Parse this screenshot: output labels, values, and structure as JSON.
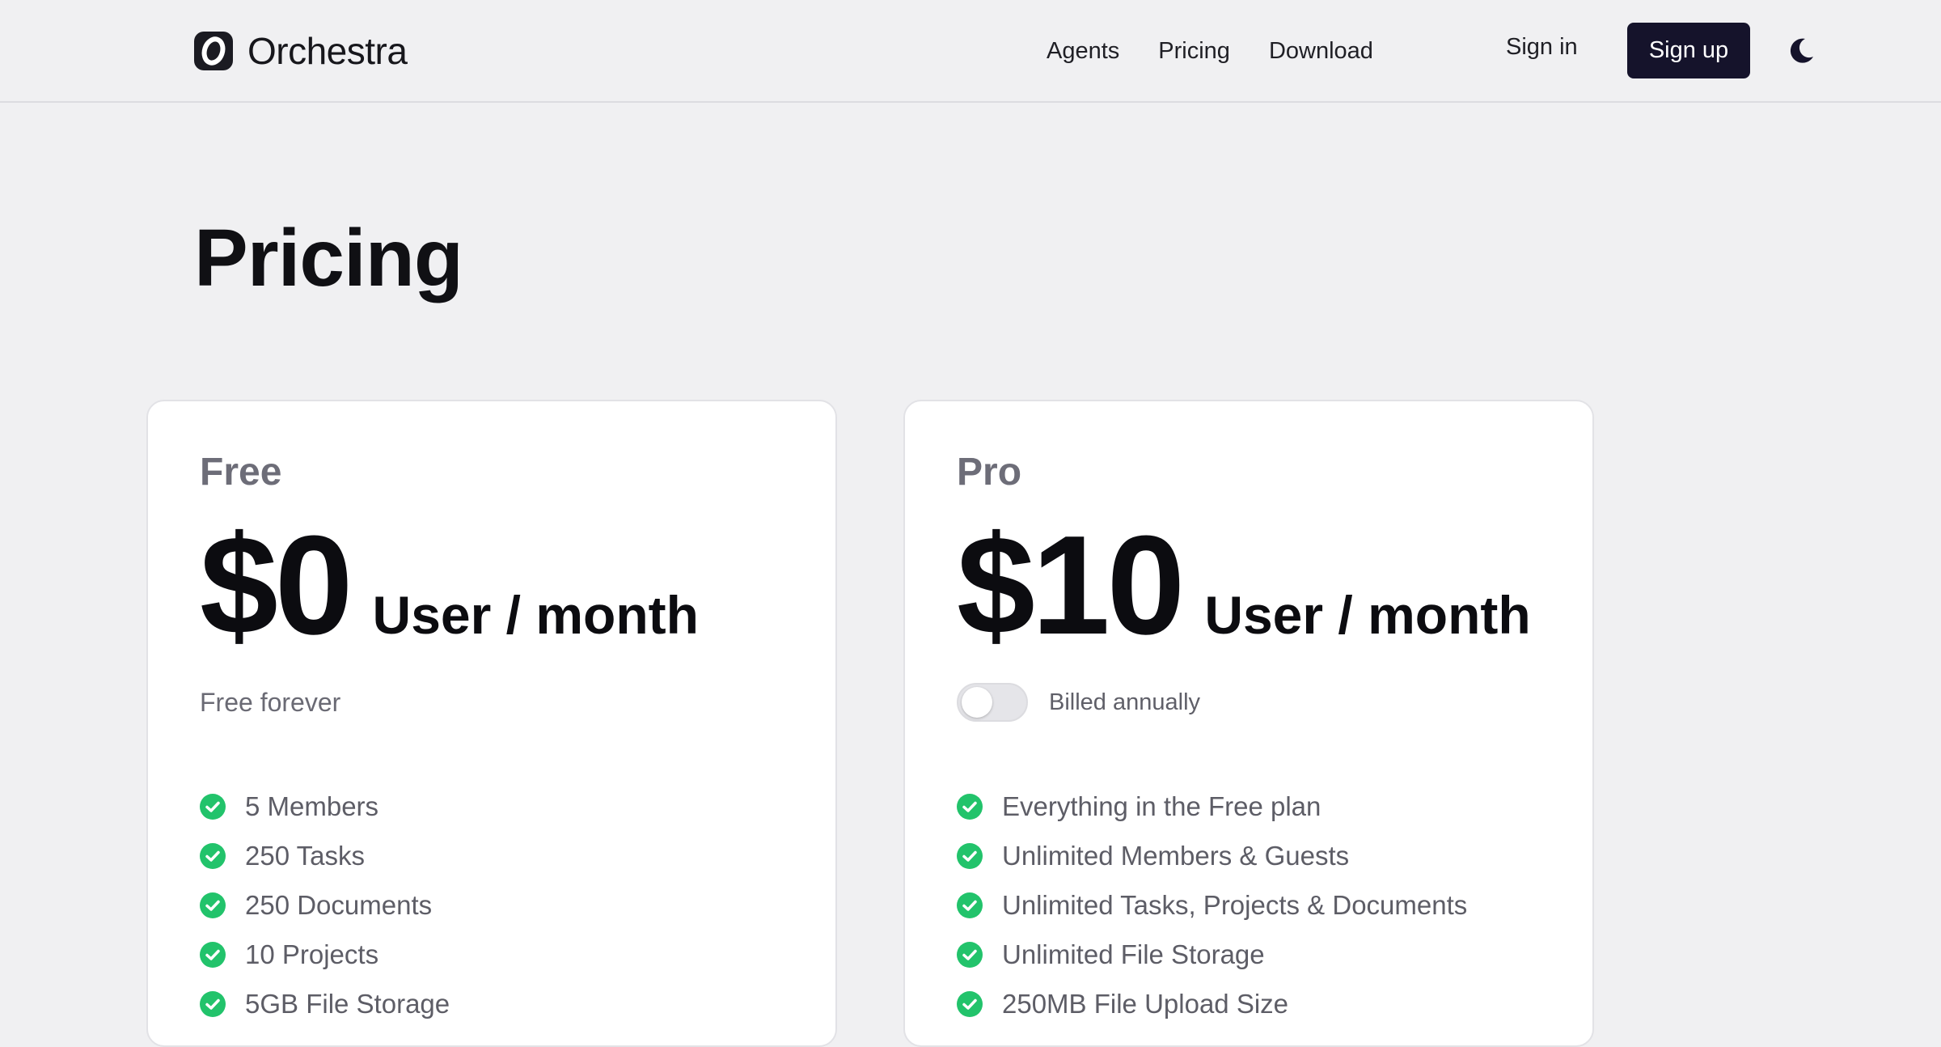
{
  "header": {
    "brand": "Orchestra",
    "nav": [
      "Agents",
      "Pricing",
      "Download"
    ],
    "sign_in": "Sign in",
    "sign_up": "Sign up"
  },
  "page": {
    "title": "Pricing"
  },
  "plans": [
    {
      "name": "Free",
      "price": "$0",
      "unit": "User / month",
      "subtitle": "Free forever",
      "features": [
        "5 Members",
        "250 Tasks",
        "250 Documents",
        "10 Projects",
        "5GB File Storage"
      ]
    },
    {
      "name": "Pro",
      "price": "$10",
      "unit": "User / month",
      "billing_label": "Billed annually",
      "billing_annual": false,
      "features": [
        "Everything in the Free plan",
        "Unlimited Members & Guests",
        "Unlimited Tasks, Projects & Documents",
        "Unlimited File Storage",
        "250MB File Upload Size"
      ]
    }
  ],
  "colors": {
    "primary_button": "#15132b",
    "check": "#22c36b",
    "background": "#f0f0f2"
  },
  "icons": {
    "theme_toggle": "moon-icon",
    "feature": "check-circle-icon"
  }
}
